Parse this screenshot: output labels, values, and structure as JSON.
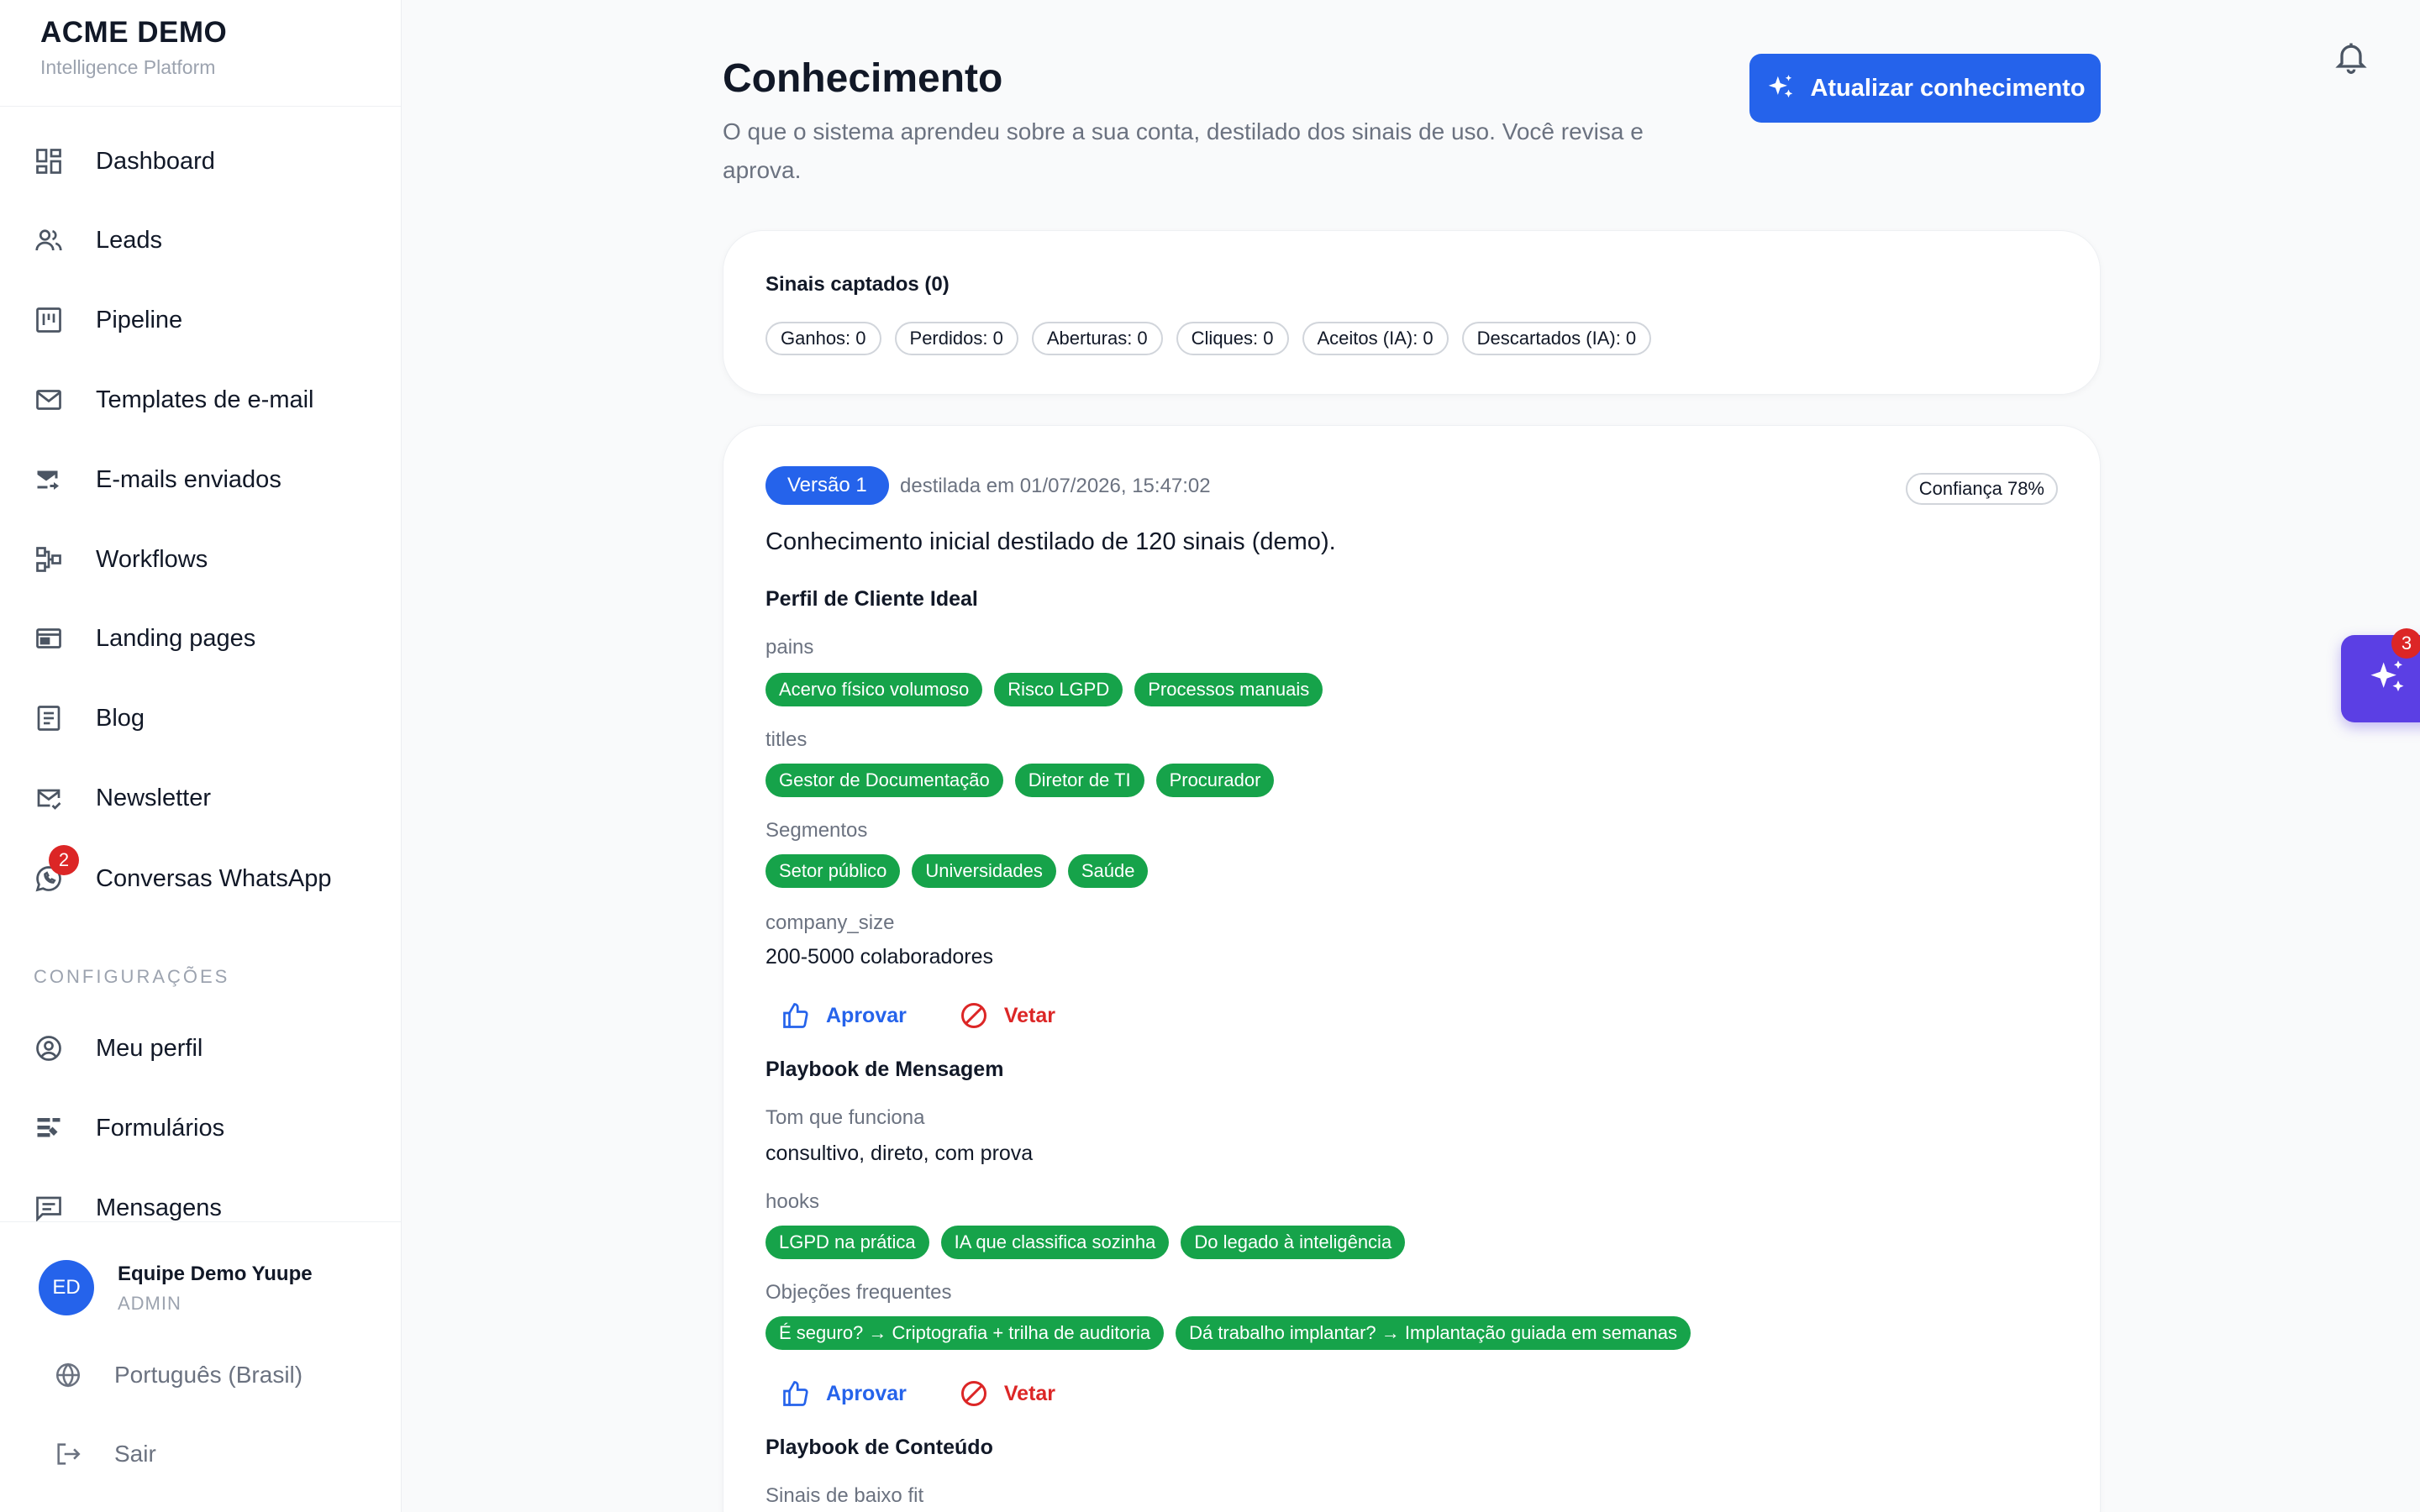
{
  "brand": {
    "name": "ACME DEMO",
    "subtitle": "Intelligence Platform"
  },
  "sidebar": {
    "items": [
      {
        "label": "Dashboard",
        "icon": "dashboard-icon"
      },
      {
        "label": "Leads",
        "icon": "users-icon"
      },
      {
        "label": "Pipeline",
        "icon": "kanban-icon"
      },
      {
        "label": "Templates de e-mail",
        "icon": "mail-icon"
      },
      {
        "label": "E-mails enviados",
        "icon": "mail-send-icon"
      },
      {
        "label": "Workflows",
        "icon": "workflow-icon"
      },
      {
        "label": "Landing pages",
        "icon": "web-icon"
      },
      {
        "label": "Blog",
        "icon": "article-icon"
      },
      {
        "label": "Newsletter",
        "icon": "mail-check-icon"
      },
      {
        "label": "Conversas WhatsApp",
        "icon": "whatsapp-icon",
        "badge": "2"
      }
    ],
    "config_label": "CONFIGURAÇÕES",
    "config_items": [
      {
        "label": "Meu perfil",
        "icon": "user-circle-icon"
      },
      {
        "label": "Formulários",
        "icon": "form-icon"
      },
      {
        "label": "Mensagens",
        "icon": "message-icon"
      }
    ],
    "user": {
      "initials": "ED",
      "name": "Equipe Demo Yuupe",
      "role": "ADMIN"
    },
    "language": "Português (Brasil)",
    "logout": "Sair"
  },
  "header": {
    "title": "Conhecimento",
    "description": "O que o sistema aprendeu sobre a sua conta, destilado dos sinais de uso. Você revisa e aprova.",
    "update_button": "Atualizar conhecimento"
  },
  "signals": {
    "title": "Sinais captados (0)",
    "pills": [
      "Ganhos: 0",
      "Perdidos: 0",
      "Aberturas: 0",
      "Cliques: 0",
      "Aceitos (IA): 0",
      "Descartados (IA): 0"
    ]
  },
  "knowledge": {
    "version": "Versão 1",
    "date": "destilada em 01/07/2026, 15:47:02",
    "confidence": "Confiança 78%",
    "summary": "Conhecimento inicial destilado de 120 sinais (demo).",
    "icp": {
      "title": "Perfil de Cliente Ideal",
      "pains_label": "pains",
      "pains": [
        "Acervo físico volumoso",
        "Risco LGPD",
        "Processos manuais"
      ],
      "titles_label": "titles",
      "titles": [
        "Gestor de Documentação",
        "Diretor de TI",
        "Procurador"
      ],
      "segments_label": "Segmentos",
      "segments": [
        "Setor público",
        "Universidades",
        "Saúde"
      ],
      "company_size_label": "company_size",
      "company_size": "200-5000 colaboradores"
    },
    "messaging": {
      "title": "Playbook de Mensagem",
      "tone_label": "Tom que funciona",
      "tone": "consultivo, direto, com prova",
      "hooks_label": "hooks",
      "hooks": [
        "LGPD na prática",
        "IA que classifica sozinha",
        "Do legado à inteligência"
      ],
      "objections_label": "Objeções frequentes",
      "objections": [
        "É seguro? → Criptografia + trilha de auditoria",
        "Dá trabalho implantar? → Implantação guiada em semanas"
      ]
    },
    "content": {
      "title": "Playbook de Conteúdo",
      "low_fit_label": "Sinais de baixo fit"
    },
    "approve_label": "Aprovar",
    "veto_label": "Vetar"
  },
  "assistant": {
    "badge": "3"
  },
  "colors": {
    "primary": "#2563eb",
    "tag_green": "#16a34a",
    "danger": "#dc2626",
    "assistant": "#5b3fe4"
  }
}
